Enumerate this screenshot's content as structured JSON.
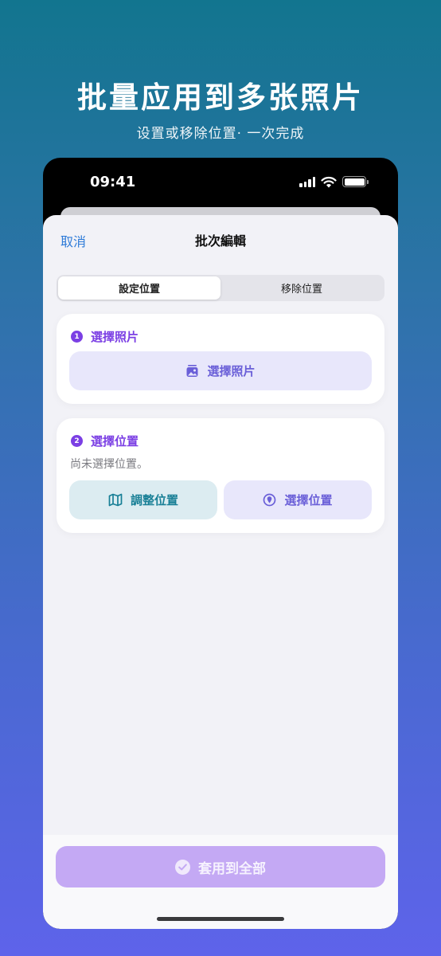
{
  "promo": {
    "headline": "批量应用到多张照片",
    "subline": "设置或移除位置· 一次完成"
  },
  "status_bar": {
    "time": "09:41",
    "icons": [
      "cellular-signal-icon",
      "wifi-icon",
      "battery-icon"
    ]
  },
  "nav": {
    "cancel_label": "取消",
    "title": "批次編輯"
  },
  "segmented": {
    "options": [
      "設定位置",
      "移除位置"
    ],
    "selected": "設定位置"
  },
  "step1": {
    "number": "1",
    "title": "選擇照片",
    "button_label": "選擇照片",
    "button_icon": "photo-stack-icon"
  },
  "step2": {
    "number": "2",
    "title": "選擇位置",
    "note": "尚未選擇位置。",
    "adjust_label": "調整位置",
    "adjust_icon": "map-icon",
    "pick_label": "選擇位置",
    "pick_icon": "location-pin-icon"
  },
  "apply": {
    "label": "套用到全部",
    "icon": "checkmark-circle-icon"
  },
  "colors": {
    "accent": "#7b3fe4",
    "link": "#2e7bd8",
    "teal": "#187f96",
    "apply_disabled": "#c4a9f4"
  }
}
